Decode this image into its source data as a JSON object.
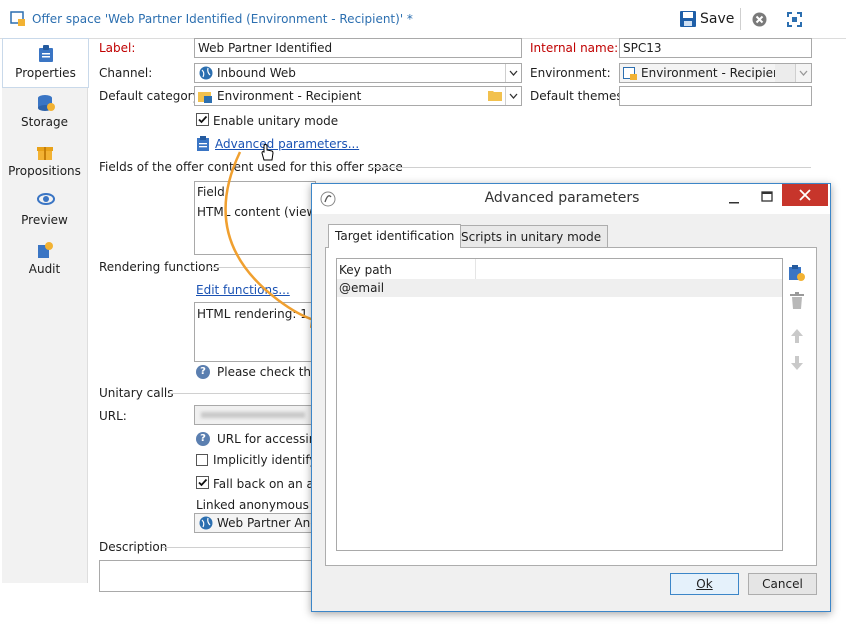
{
  "window": {
    "title": "Offer space 'Web Partner Identified (Environment - Recipient)' *",
    "save_label": "Save"
  },
  "sidebar": {
    "items": [
      {
        "label": "Properties",
        "icon": "clipboard-icon"
      },
      {
        "label": "Storage",
        "icon": "database-icon"
      },
      {
        "label": "Propositions",
        "icon": "gift-icon"
      },
      {
        "label": "Preview",
        "icon": "eye-icon"
      },
      {
        "label": "Audit",
        "icon": "audit-icon"
      }
    ]
  },
  "form": {
    "label_caption": "Label:",
    "label_value": "Web Partner Identified",
    "internal_name_caption": "Internal name:",
    "internal_name_value": "SPC13",
    "channel_caption": "Channel:",
    "channel_value": "Inbound Web",
    "environment_caption": "Environment:",
    "environment_value": "Environment - Recipient (",
    "default_category_caption": "Default category:",
    "default_category_value": "Environment - Recipient",
    "default_themes_caption": "Default themes:",
    "default_themes_value": "",
    "enable_unitary_label": "Enable unitary mode",
    "advanced_params_link": "Advanced parameters...",
    "fields_section": "Fields of the offer content used for this offer space",
    "field_col": "Field",
    "field_row": "HTML content (view/",
    "rendering_section": "Rendering functions",
    "edit_functions_link": "Edit functions...",
    "html_rendering": "HTML rendering: 1",
    "please_check": "Please check that",
    "unitary_calls_section": "Unitary calls",
    "url_caption": "URL:",
    "url_hint": "URL for accessing",
    "implicitly_label": "Implicitly identify t",
    "fall_back_label": "Fall back on an ano",
    "linked_anon_label": "Linked anonymous sp",
    "linked_anon_value": "Web Partner Anor",
    "description_section": "Description"
  },
  "dialog": {
    "title": "Advanced parameters",
    "tabs": [
      "Target identification",
      "Scripts in unitary mode"
    ],
    "column_header": "Key path",
    "rows": [
      "@email"
    ],
    "ok_label": "Ok",
    "cancel_label": "Cancel"
  },
  "colors": {
    "link": "#1a52b3",
    "required_label": "#c00000",
    "accent": "#2c6fb0",
    "arrow": "#f0a030"
  }
}
